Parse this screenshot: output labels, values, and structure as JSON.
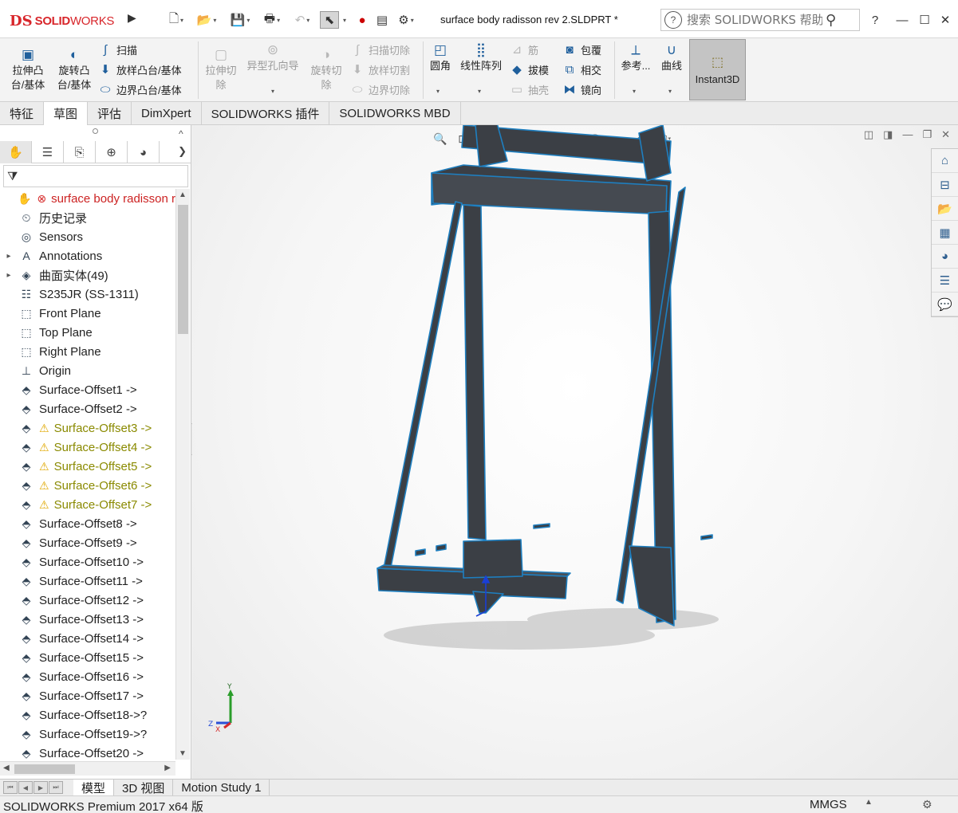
{
  "app": {
    "logo_mark": "DS",
    "logo_text_a": "SOLID",
    "logo_text_b": "WORKS",
    "document_title": "surface body radisson rev 2.SLDPRT *"
  },
  "quick_access": {
    "icons": [
      "new-file-icon",
      "open-file-icon",
      "save-icon",
      "print-icon",
      "undo-icon",
      "select-icon",
      "rebuild-icon",
      "file-properties-icon",
      "options-gear-icon"
    ]
  },
  "help_search": {
    "placeholder": "搜索 SOLIDWORKS 帮助"
  },
  "window_controls": {
    "help": "?",
    "minimize": "—",
    "restore": "☐",
    "close": "✕"
  },
  "ribbon": {
    "extrude_boss": "拉伸凸\n台/基体",
    "revolve_boss": "旋转凸\n台/基体",
    "sweep": "扫描",
    "loft": "放样凸台/基体",
    "boundary_boss": "边界凸台/基体",
    "extrude_cut": "拉伸切\n除",
    "hole_wizard": "异型孔向导",
    "revolve_cut": "旋转切\n除",
    "swept_cut": "扫描切除",
    "lofted_cut": "放样切割",
    "boundary_cut": "边界切除",
    "fillet": "圆角",
    "linear_pattern": "线性阵列",
    "rib": "筋",
    "draft": "拔模",
    "shell": "抽壳",
    "wrap": "包覆",
    "intersect": "相交",
    "mirror": "镜向",
    "reference_geometry": "参考...",
    "curves": "曲线",
    "instant3d": "Instant3D"
  },
  "command_tabs": [
    "特征",
    "草图",
    "评估",
    "DimXpert",
    "SOLIDWORKS 插件",
    "SOLIDWORKS MBD"
  ],
  "feature_tree": {
    "items": [
      {
        "label": "surface body radisson r",
        "icon": "part-icon",
        "expand": "",
        "state": "root"
      },
      {
        "label": "历史记录",
        "icon": "history-icon",
        "expand": "",
        "state": ""
      },
      {
        "label": "Sensors",
        "icon": "sensor-icon",
        "expand": "",
        "state": ""
      },
      {
        "label": "Annotations",
        "icon": "annotation-icon",
        "expand": "▸",
        "state": ""
      },
      {
        "label": "曲面实体(49)",
        "icon": "surface-bodies-icon",
        "expand": "▸",
        "state": ""
      },
      {
        "label": "S235JR (SS-1311)",
        "icon": "material-icon",
        "expand": "",
        "state": ""
      },
      {
        "label": "Front Plane",
        "icon": "plane-icon",
        "expand": "",
        "state": ""
      },
      {
        "label": "Top Plane",
        "icon": "plane-icon",
        "expand": "",
        "state": ""
      },
      {
        "label": "Right Plane",
        "icon": "plane-icon",
        "expand": "",
        "state": ""
      },
      {
        "label": "Origin",
        "icon": "origin-icon",
        "expand": "",
        "state": ""
      },
      {
        "label": "Surface-Offset1 ->",
        "icon": "offset-surface-icon",
        "expand": "",
        "state": ""
      },
      {
        "label": "Surface-Offset2 ->",
        "icon": "offset-surface-icon",
        "expand": "",
        "state": ""
      },
      {
        "label": "Surface-Offset3 ->",
        "icon": "offset-surface-icon",
        "expand": "",
        "state": "warning"
      },
      {
        "label": "Surface-Offset4 ->",
        "icon": "offset-surface-icon",
        "expand": "",
        "state": "warning"
      },
      {
        "label": "Surface-Offset5 ->",
        "icon": "offset-surface-icon",
        "expand": "",
        "state": "warning"
      },
      {
        "label": "Surface-Offset6 ->",
        "icon": "offset-surface-icon",
        "expand": "",
        "state": "warning"
      },
      {
        "label": "Surface-Offset7 ->",
        "icon": "offset-surface-icon",
        "expand": "",
        "state": "warning"
      },
      {
        "label": "Surface-Offset8 ->",
        "icon": "offset-surface-icon",
        "expand": "",
        "state": ""
      },
      {
        "label": "Surface-Offset9 ->",
        "icon": "offset-surface-icon",
        "expand": "",
        "state": ""
      },
      {
        "label": "Surface-Offset10 ->",
        "icon": "offset-surface-icon",
        "expand": "",
        "state": ""
      },
      {
        "label": "Surface-Offset11 ->",
        "icon": "offset-surface-icon",
        "expand": "",
        "state": ""
      },
      {
        "label": "Surface-Offset12 ->",
        "icon": "offset-surface-icon",
        "expand": "",
        "state": ""
      },
      {
        "label": "Surface-Offset13 ->",
        "icon": "offset-surface-icon",
        "expand": "",
        "state": ""
      },
      {
        "label": "Surface-Offset14 ->",
        "icon": "offset-surface-icon",
        "expand": "",
        "state": ""
      },
      {
        "label": "Surface-Offset15 ->",
        "icon": "offset-surface-icon",
        "expand": "",
        "state": ""
      },
      {
        "label": "Surface-Offset16 ->",
        "icon": "offset-surface-icon",
        "expand": "",
        "state": ""
      },
      {
        "label": "Surface-Offset17 ->",
        "icon": "offset-surface-icon",
        "expand": "",
        "state": ""
      },
      {
        "label": "Surface-Offset18->?",
        "icon": "offset-surface-icon",
        "expand": "",
        "state": ""
      },
      {
        "label": "Surface-Offset19->?",
        "icon": "offset-surface-icon",
        "expand": "",
        "state": ""
      },
      {
        "label": "Surface-Offset20 ->",
        "icon": "offset-surface-icon",
        "expand": "",
        "state": ""
      }
    ]
  },
  "triad": {
    "x": "X",
    "y": "Y",
    "z": "Z"
  },
  "bottom_tabs": [
    "模型",
    "3D 视图",
    "Motion Study 1"
  ],
  "status": {
    "message": "SOLIDWORKS Premium 2017 x64 版",
    "units": "MMGS"
  },
  "colors": {
    "brand_red": "#d8262b",
    "model_body": "#3b3f45",
    "model_edge": "#1e7fc0",
    "warning": "#e0a800"
  }
}
